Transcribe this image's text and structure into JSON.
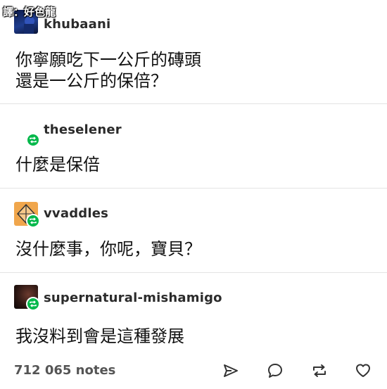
{
  "watermark": "譯：好色龍",
  "posts": [
    {
      "username": "khubaani",
      "text": "你寧願吃下一公斤的磚頭\n還是一公斤的保倍？",
      "reblog": false
    },
    {
      "username": "theselener",
      "text": "什麼是保倍",
      "reblog": true
    },
    {
      "username": "vvaddles",
      "text": "沒什麼事，你呢，寶貝？",
      "reblog": true
    },
    {
      "username": "supernatural-mishamigo",
      "text": "我沒料到會是這種發展",
      "reblog": true
    }
  ],
  "footer": {
    "notes": "712 065 notes",
    "actions": [
      "share-icon",
      "comment-icon",
      "reblog-icon",
      "like-icon"
    ]
  },
  "colors": {
    "reblog_green": "#00b84a",
    "divider": "#e3e3e3",
    "icon_gray": "#333333"
  }
}
